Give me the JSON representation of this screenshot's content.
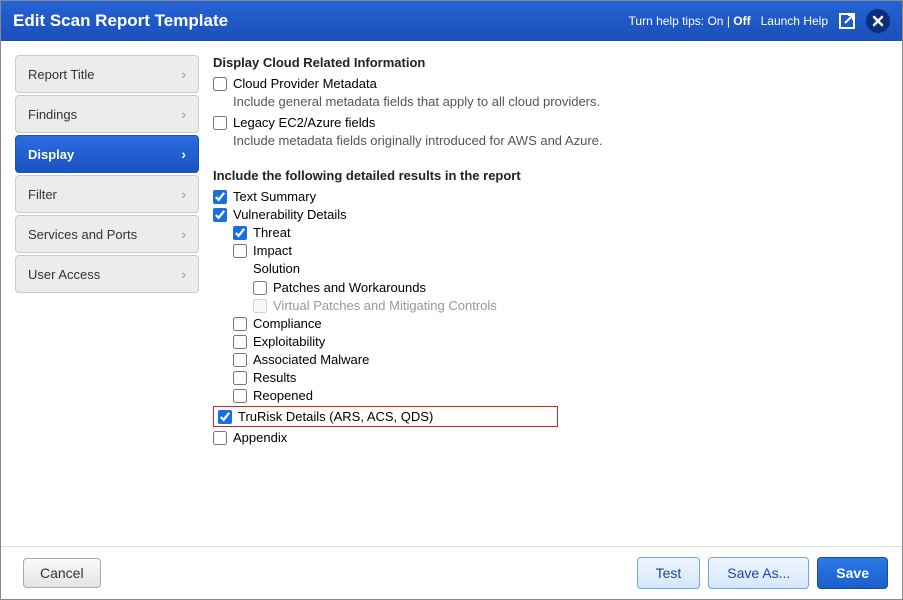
{
  "title": "Edit Scan Report Template",
  "tips_prefix": "Turn help tips:",
  "tips_on": "On",
  "tips_sep": "|",
  "tips_off": "Off",
  "launch_help": "Launch Help",
  "sidebar": {
    "items": [
      {
        "label": "Report Title"
      },
      {
        "label": "Findings"
      },
      {
        "label": "Display"
      },
      {
        "label": "Filter"
      },
      {
        "label": "Services and Ports"
      },
      {
        "label": "User Access"
      }
    ],
    "active_index": 2
  },
  "content": {
    "cloud_heading": "Display Cloud Related Information",
    "cloud_provider": {
      "label": "Cloud Provider Metadata",
      "checked": false,
      "desc": "Include general metadata fields that apply to all cloud providers."
    },
    "legacy": {
      "label": "Legacy EC2/Azure fields",
      "checked": false,
      "desc": "Include metadata fields originally introduced for AWS and Azure."
    },
    "detailed_heading": "Include the following detailed results in the report",
    "text_summary": {
      "label": "Text Summary",
      "checked": true
    },
    "vuln_details": {
      "label": "Vulnerability Details",
      "checked": true
    },
    "threat": {
      "label": "Threat",
      "checked": true
    },
    "impact": {
      "label": "Impact",
      "checked": false
    },
    "solution_label": "Solution",
    "patches": {
      "label": "Patches and Workarounds",
      "checked": false
    },
    "virtual": {
      "label": "Virtual Patches and Mitigating Controls",
      "checked": false,
      "disabled": true
    },
    "compliance": {
      "label": "Compliance",
      "checked": false
    },
    "exploitability": {
      "label": "Exploitability",
      "checked": false
    },
    "malware": {
      "label": "Associated Malware",
      "checked": false
    },
    "results": {
      "label": "Results",
      "checked": false
    },
    "reopened": {
      "label": "Reopened",
      "checked": false
    },
    "trurisk": {
      "label": "TruRisk Details (ARS, ACS, QDS)",
      "checked": true
    },
    "appendix": {
      "label": "Appendix",
      "checked": false
    }
  },
  "footer": {
    "cancel": "Cancel",
    "test": "Test",
    "save_as": "Save As...",
    "save": "Save"
  }
}
